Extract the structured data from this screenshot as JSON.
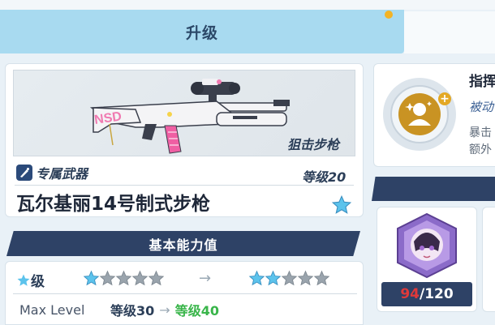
{
  "header": {
    "upgrade_tab": "升级"
  },
  "weapon": {
    "type": "狙击步枪",
    "exclusive_label": "专属武器",
    "level": "等级20",
    "name": "瓦尔基丽14号制式步枪",
    "decal_text": "NSD"
  },
  "stats": {
    "header": "基本能力值",
    "star_label": "级",
    "star_before": 1,
    "star_after": 2,
    "star_total": 5,
    "arrow": "→",
    "maxlevel_label": "Max Level",
    "maxlevel_before": "等级30",
    "maxlevel_after": "等级40"
  },
  "skill": {
    "name": "指挥",
    "type": "被动",
    "desc_line1": "暴击",
    "desc_line2": "额外",
    "plus": "+"
  },
  "material": {
    "have": "94",
    "need": "/120"
  },
  "colors": {
    "accent_navy": "#2e4266",
    "tab_blue": "#a8daf0",
    "green": "#39b54a",
    "red": "#e0393a",
    "star_blue": "#5cc3ec",
    "star_gray": "#9aa4ad",
    "skill_gold": "#e3a825"
  },
  "icons": {
    "exclusive": "weapon-exclusive-icon",
    "skill": "commander-skill-icon",
    "star": "star-icon",
    "material": "purple-crystal-icon"
  }
}
